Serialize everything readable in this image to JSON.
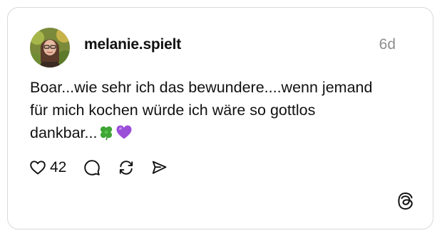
{
  "post": {
    "username": "melanie.spielt",
    "timestamp": "6d",
    "text_lines": [
      "Boar...wie sehr ich das bewundere....wenn jemand",
      "für mich kochen würde ich wäre so gottlos",
      "dankbar..."
    ],
    "emojis": [
      "four-leaf-clover-emoji",
      "purple-heart-emoji"
    ]
  },
  "actions": {
    "like_count": "42",
    "icons": [
      "heart-icon",
      "comment-icon",
      "repost-icon",
      "share-icon"
    ]
  },
  "colors": {
    "text": "#111111",
    "muted": "#8e8e8e",
    "border": "#d9d9d9",
    "purple_heart": "#9b4fd8",
    "clover": "#3fa535"
  },
  "brand": {
    "logo": "threads-logo-icon"
  }
}
